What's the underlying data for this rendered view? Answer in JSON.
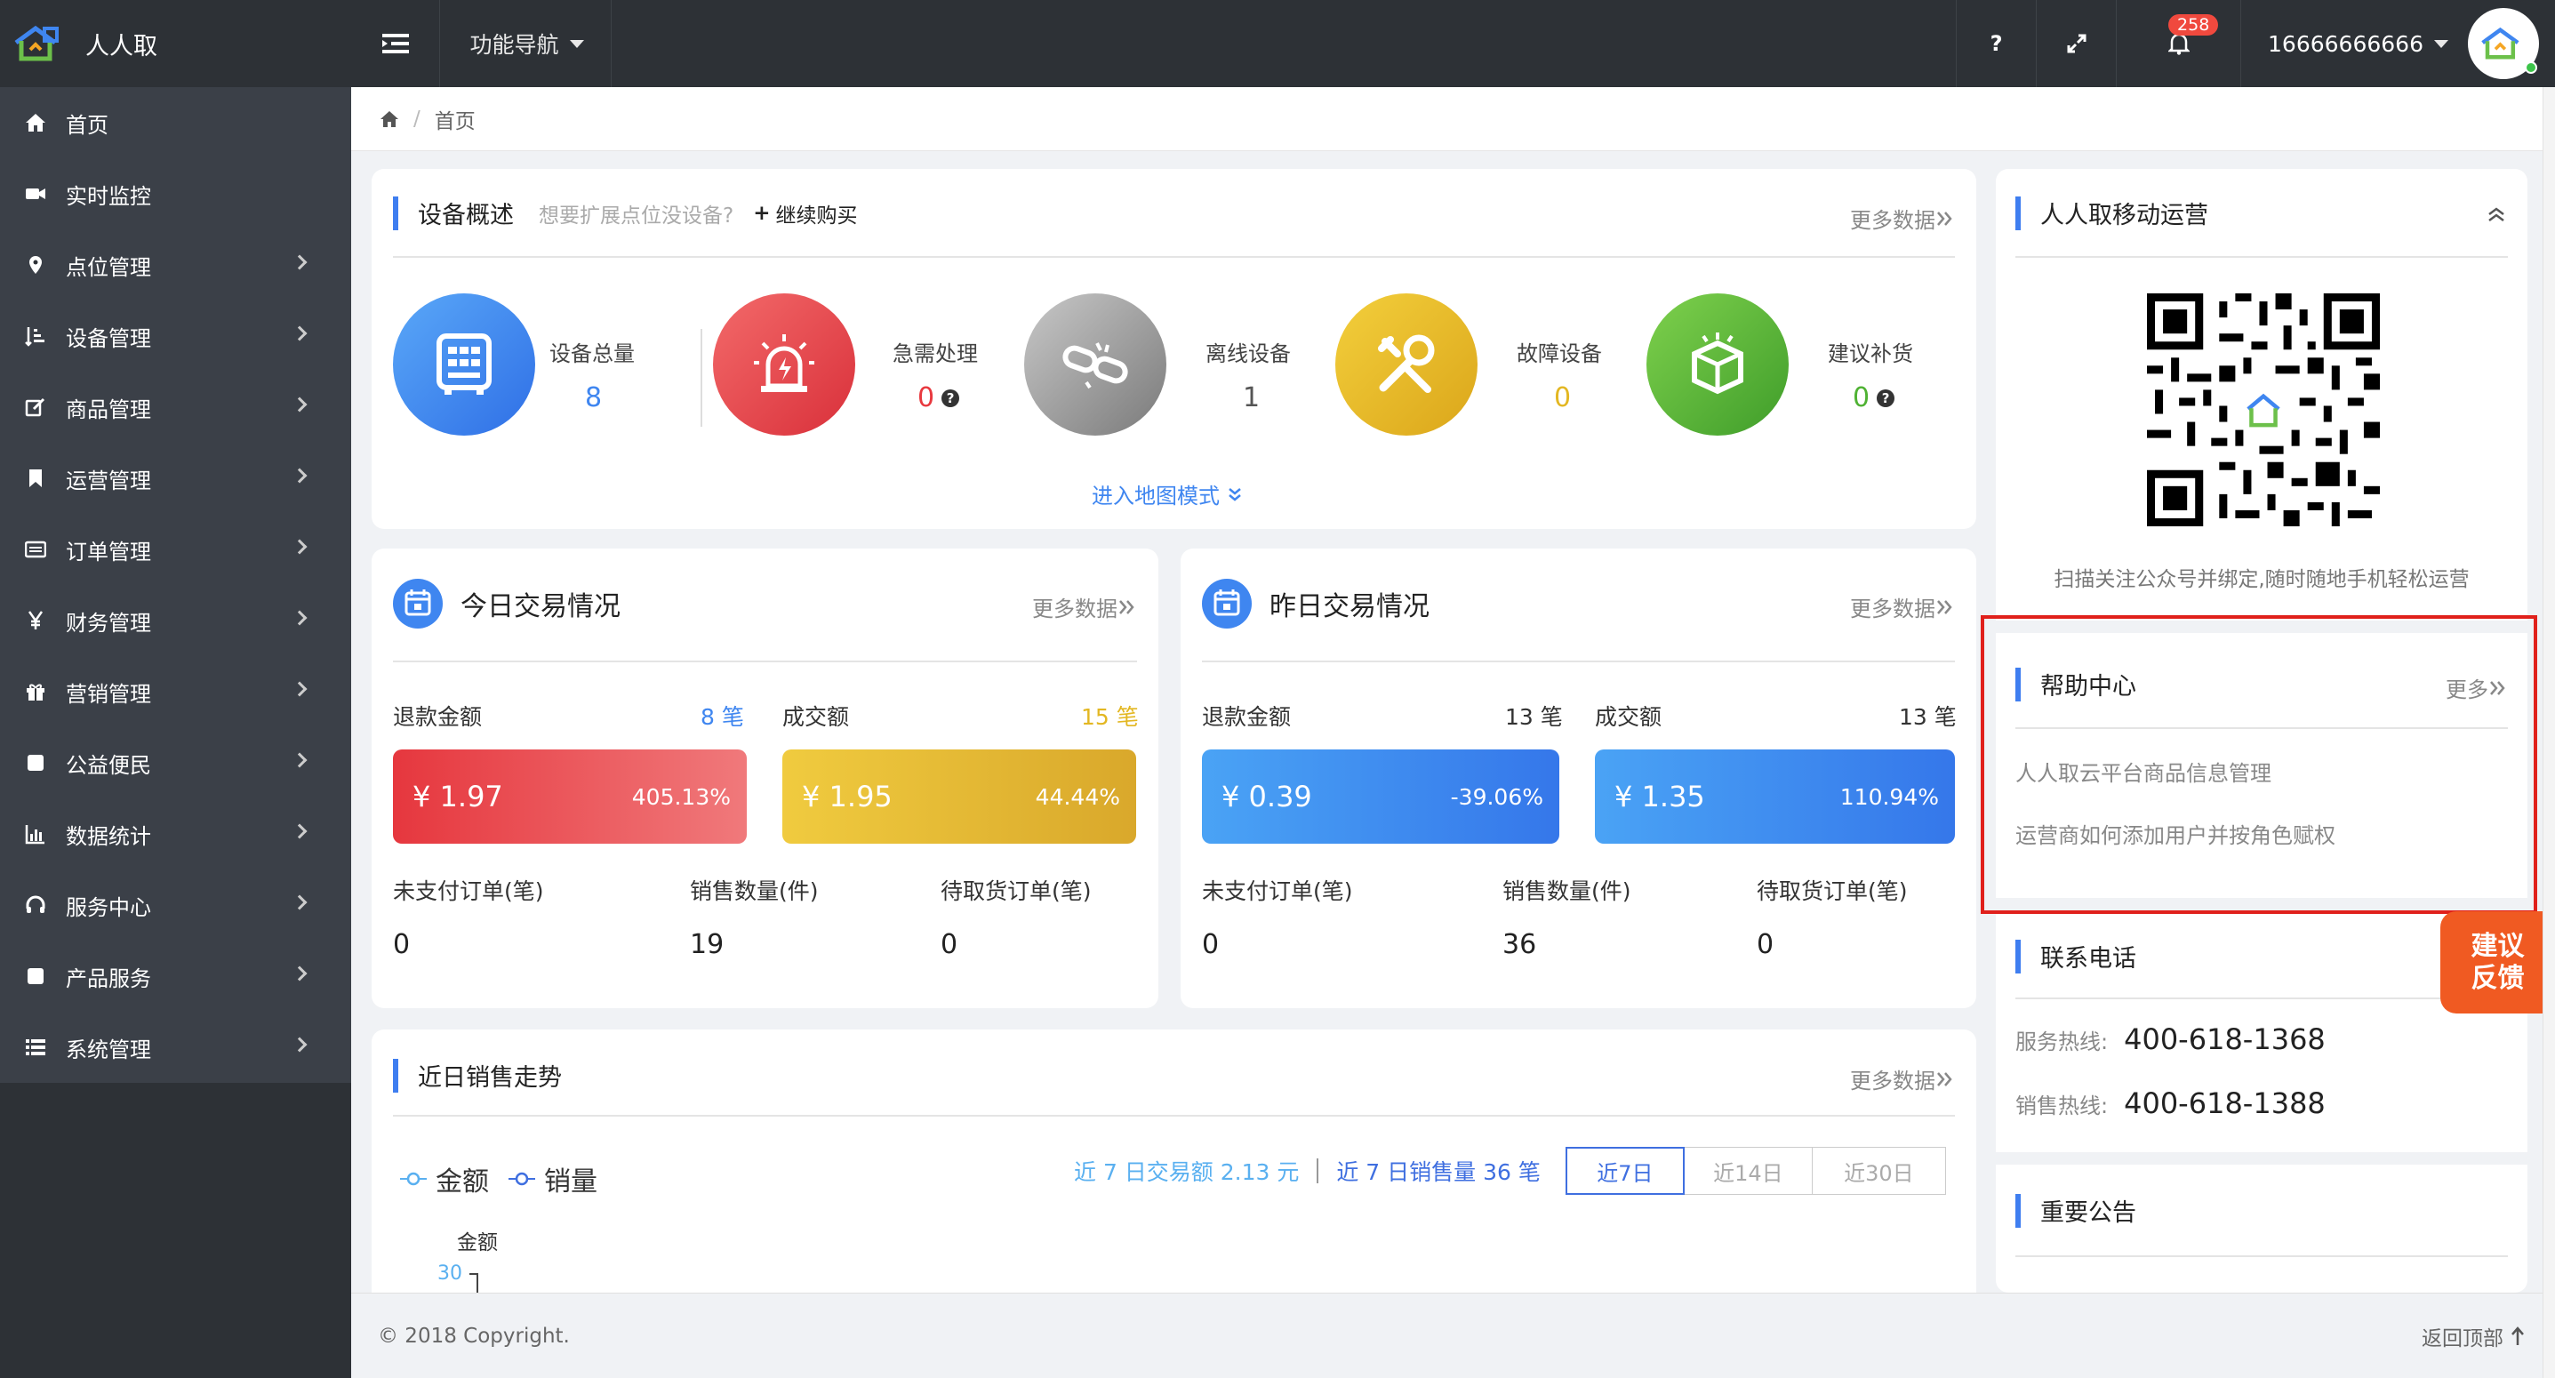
{
  "header": {
    "logo_text": "人人取",
    "nav_label": "功能导航",
    "help_label": "?",
    "notification_count": "258",
    "username": "16666666666"
  },
  "sidebar": {
    "items": [
      {
        "label": "首页",
        "icon": "home-icon"
      },
      {
        "label": "实时监控",
        "icon": "video-camera-icon"
      },
      {
        "label": "点位管理",
        "icon": "map-pin-icon"
      },
      {
        "label": "设备管理",
        "icon": "sort-bars-icon"
      },
      {
        "label": "商品管理",
        "icon": "edit-icon"
      },
      {
        "label": "运营管理",
        "icon": "bookmark-icon"
      },
      {
        "label": "订单管理",
        "icon": "list-card-icon"
      },
      {
        "label": "财务管理",
        "icon": "yen-icon"
      },
      {
        "label": "营销管理",
        "icon": "gift-icon"
      },
      {
        "label": "公益便民",
        "icon": "square-icon"
      },
      {
        "label": "数据统计",
        "icon": "bar-chart-icon"
      },
      {
        "label": "服务中心",
        "icon": "headset-icon"
      },
      {
        "label": "产品服务",
        "icon": "square-icon"
      },
      {
        "label": "系统管理",
        "icon": "list-icon"
      }
    ]
  },
  "breadcrumb": {
    "home": "首页",
    "sep": "/"
  },
  "device_overview": {
    "title": "设备概述",
    "hint": "想要扩展点位没设备?",
    "buy_label": "继续购买",
    "more": "更多数据",
    "map_mode": "进入地图模式",
    "stats": [
      {
        "label": "设备总量",
        "value": "8",
        "color": "#3f86f0"
      },
      {
        "label": "急需处理",
        "value": "0",
        "color": "#e8393f"
      },
      {
        "label": "离线设备",
        "value": "1",
        "color": "#555555"
      },
      {
        "label": "故障设备",
        "value": "0",
        "color": "#e3b722"
      },
      {
        "label": "建议补货",
        "value": "0",
        "color": "#4fb233"
      }
    ]
  },
  "today": {
    "title": "今日交易情况",
    "more": "更多数据",
    "refund_label": "退款金额",
    "refund_count": "8 笔",
    "deal_label": "成交额",
    "deal_count": "15 笔",
    "refund_amount": "¥ 1.97",
    "refund_pct": "405.13%",
    "deal_amount": "¥ 1.95",
    "deal_pct": "44.44%",
    "unpaid_label": "未支付订单(笔)",
    "sales_label": "销售数量(件)",
    "pending_label": "待取货订单(笔)",
    "unpaid": "0",
    "sales": "19",
    "pending": "0"
  },
  "yesterday": {
    "title": "昨日交易情况",
    "more": "更多数据",
    "refund_label": "退款金额",
    "refund_count": "13 笔",
    "deal_label": "成交额",
    "deal_count": "13 笔",
    "refund_amount": "¥ 0.39",
    "refund_pct": "-39.06%",
    "deal_amount": "¥ 1.35",
    "deal_pct": "110.94%",
    "unpaid_label": "未支付订单(笔)",
    "sales_label": "销售数量(件)",
    "pending_label": "待取货订单(笔)",
    "unpaid": "0",
    "sales": "36",
    "pending": "0"
  },
  "trend": {
    "title": "近日销售走势",
    "more": "更多数据",
    "legend_amount": "金额",
    "legend_volume": "销量",
    "summary_amount": "近 7 日交易额 2.13 元",
    "summary_volume": "近 7 日销售量 36 笔",
    "periods": [
      "近7日",
      "近14日",
      "近30日"
    ],
    "active_period": "近7日",
    "axis_label": "金额",
    "axis_tick": "30"
  },
  "mobile": {
    "title": "人人取移动运营",
    "caption": "扫描关注公众号并绑定,随时随地手机轻松运营"
  },
  "help": {
    "title": "帮助中心",
    "more": "更多",
    "links": [
      "人人取云平台商品信息管理",
      "运营商如何添加用户并按角色赋权"
    ]
  },
  "contact": {
    "title": "联系电话",
    "service_label": "服务热线:",
    "service_phone": "400-618-1368",
    "sales_label": "销售热线:",
    "sales_phone": "400-618-1388"
  },
  "notice": {
    "title": "重要公告"
  },
  "feedback": {
    "line1": "建议",
    "line2": "反馈"
  },
  "footer": {
    "copyright": "© 2018 Copyright.",
    "back_top": "返回顶部"
  }
}
